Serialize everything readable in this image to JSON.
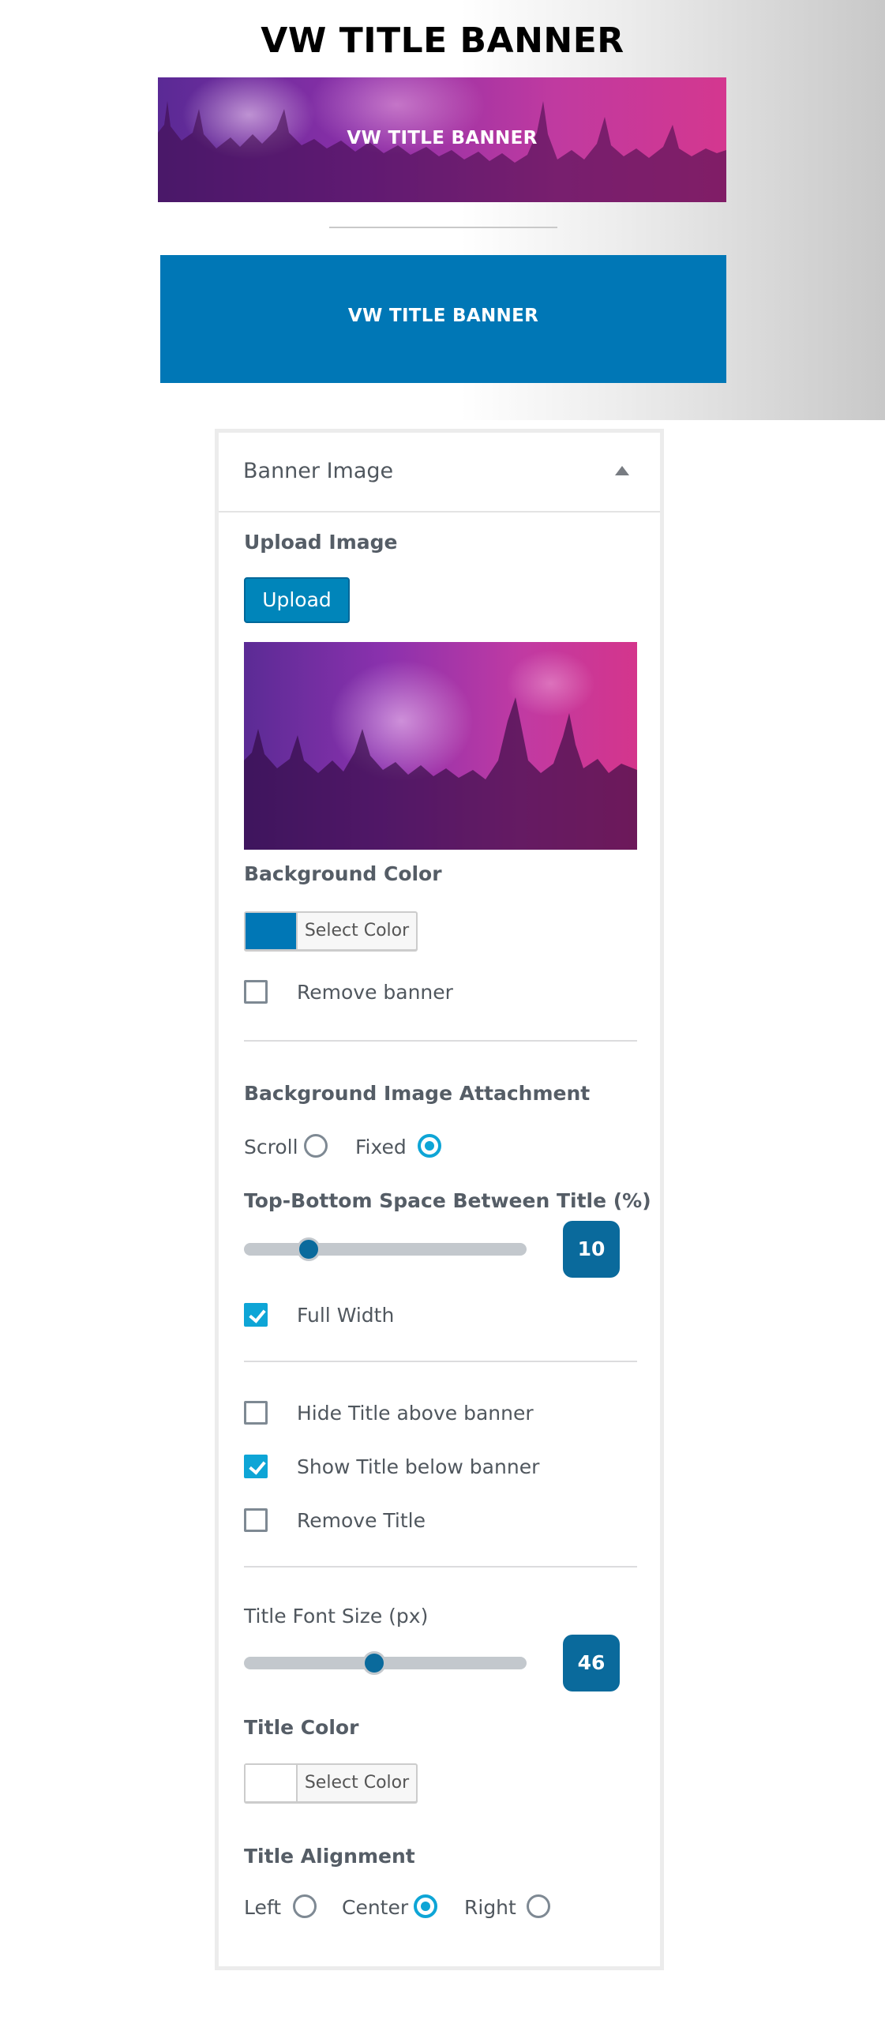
{
  "hero": {
    "title": "VW TITLE BANNER",
    "image_banner_text": "VW TITLE BANNER",
    "color_banner_text": "VW TITLE BANNER",
    "color_banner_bg": "#0077b6"
  },
  "panel": {
    "header_title": "Banner Image",
    "upload": {
      "label": "Upload Image",
      "button": "Upload"
    },
    "background_color": {
      "label": "Background Color",
      "swatch": "#0077b6",
      "button": "Select Color"
    },
    "remove_banner": {
      "label": "Remove banner",
      "checked": false
    },
    "attachment": {
      "label": "Background Image Attachment",
      "options": [
        {
          "label": "Scroll",
          "selected": false
        },
        {
          "label": "Fixed",
          "selected": true
        }
      ]
    },
    "spacing": {
      "label": "Top-Bottom Space Between Title (%)",
      "value": "10",
      "fraction": 0.23
    },
    "full_width": {
      "label": "Full Width",
      "checked": true
    },
    "title_options": [
      {
        "label": "Hide Title above banner",
        "checked": false
      },
      {
        "label": "Show Title below banner",
        "checked": true
      },
      {
        "label": "Remove Title",
        "checked": false
      }
    ],
    "font_size": {
      "label": "Title Font Size (px)",
      "value": "46",
      "fraction": 0.46
    },
    "title_color": {
      "label": "Title Color",
      "swatch": "#ffffff",
      "button": "Select Color"
    },
    "alignment": {
      "label": "Title Alignment",
      "options": [
        {
          "label": "Left",
          "selected": false
        },
        {
          "label": "Center",
          "selected": true
        },
        {
          "label": "Right",
          "selected": false
        }
      ]
    }
  }
}
